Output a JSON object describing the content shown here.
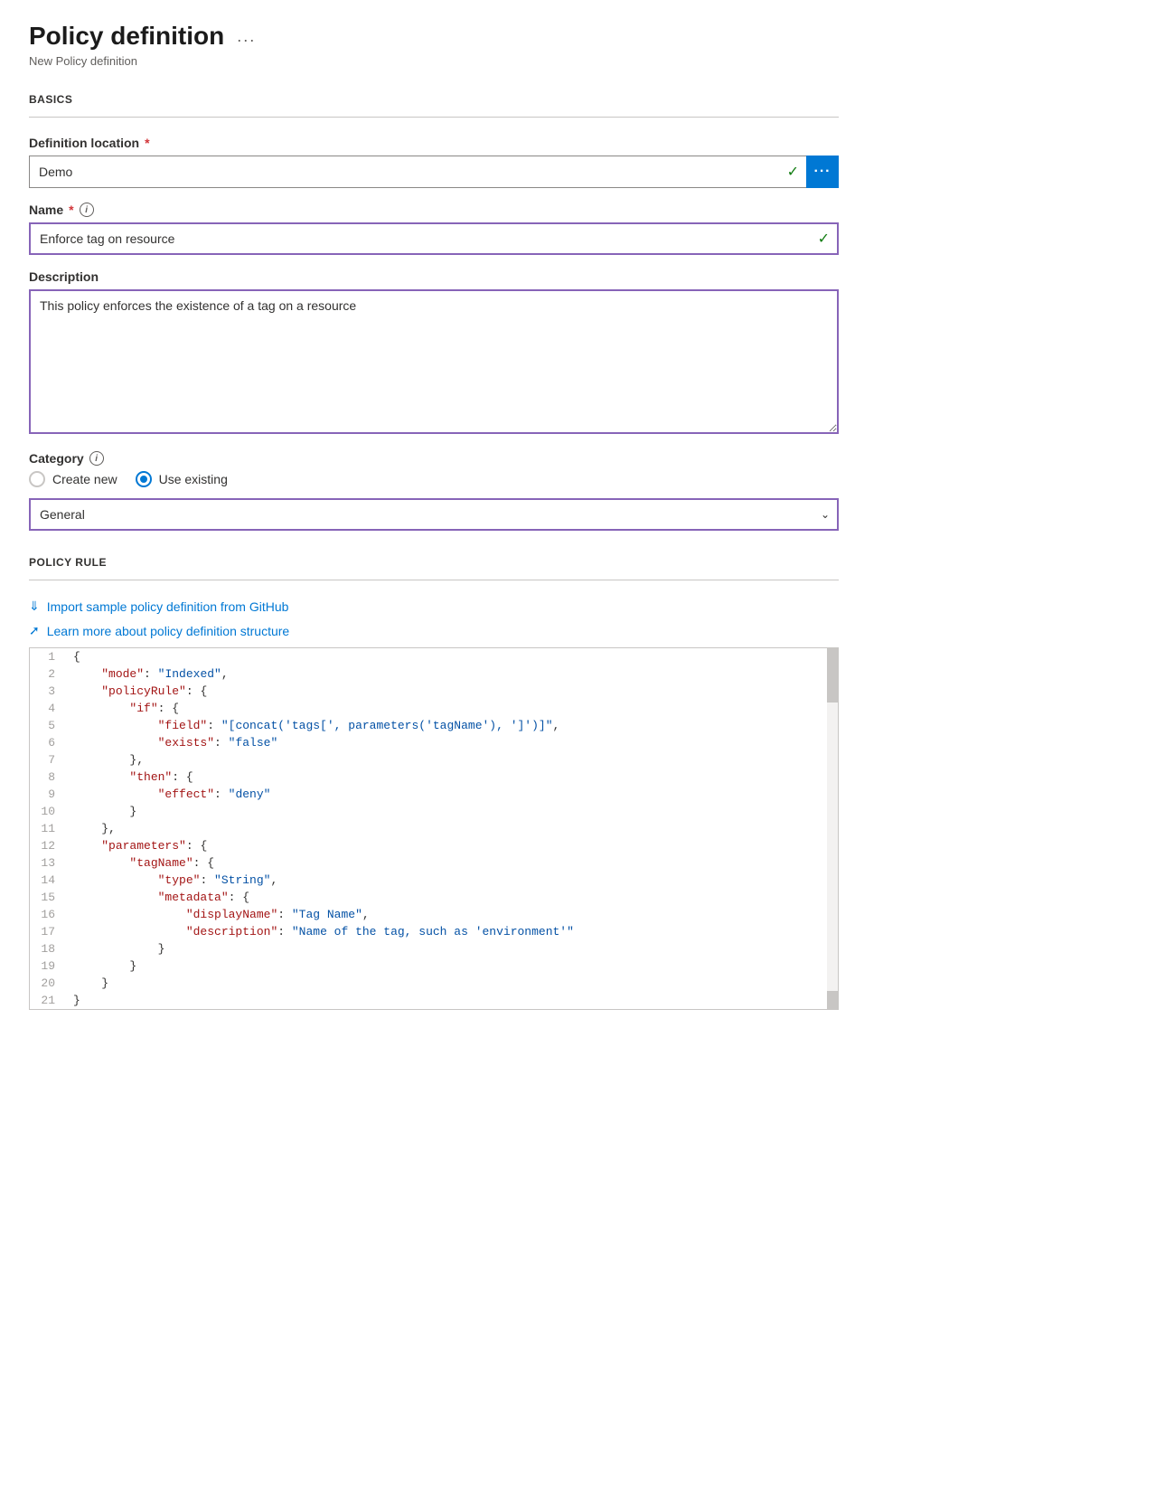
{
  "header": {
    "title": "Policy definition",
    "ellipsis": "...",
    "subtitle": "New Policy definition"
  },
  "sections": {
    "basics_heading": "BASICS",
    "policy_rule_heading": "POLICY RULE"
  },
  "fields": {
    "definition_location": {
      "label": "Definition location",
      "required": true,
      "value": "Demo",
      "info": null
    },
    "name": {
      "label": "Name",
      "required": true,
      "value": "Enforce tag on resource",
      "info": "i"
    },
    "description": {
      "label": "Description",
      "required": false,
      "value": "This policy enforces the existence of a tag on a resource"
    },
    "category": {
      "label": "Category",
      "required": false,
      "info": "i",
      "radio_create_new": "Create new",
      "radio_use_existing": "Use existing",
      "selected_radio": "use_existing",
      "selected_value": "General"
    }
  },
  "policy_rule": {
    "import_link": "Import sample policy definition from GitHub",
    "learn_link": "Learn more about policy definition structure",
    "code_lines": [
      {
        "num": 1,
        "content": "{"
      },
      {
        "num": 2,
        "content": "    \"mode\": \"Indexed\","
      },
      {
        "num": 3,
        "content": "    \"policyRule\": {"
      },
      {
        "num": 4,
        "content": "        \"if\": {"
      },
      {
        "num": 5,
        "content": "            \"field\": \"[concat('tags[', parameters('tagName'), ']')]\","
      },
      {
        "num": 6,
        "content": "            \"exists\": \"false\""
      },
      {
        "num": 7,
        "content": "        },"
      },
      {
        "num": 8,
        "content": "        \"then\": {"
      },
      {
        "num": 9,
        "content": "            \"effect\": \"deny\""
      },
      {
        "num": 10,
        "content": "        }"
      },
      {
        "num": 11,
        "content": "    },"
      },
      {
        "num": 12,
        "content": "    \"parameters\": {"
      },
      {
        "num": 13,
        "content": "        \"tagName\": {"
      },
      {
        "num": 14,
        "content": "            \"type\": \"String\","
      },
      {
        "num": 15,
        "content": "            \"metadata\": {"
      },
      {
        "num": 16,
        "content": "                \"displayName\": \"Tag Name\","
      },
      {
        "num": 17,
        "content": "                \"description\": \"Name of the tag, such as 'environment'\""
      },
      {
        "num": 18,
        "content": "            }"
      },
      {
        "num": 19,
        "content": "        }"
      },
      {
        "num": 20,
        "content": "    }"
      },
      {
        "num": 21,
        "content": "}"
      }
    ]
  }
}
